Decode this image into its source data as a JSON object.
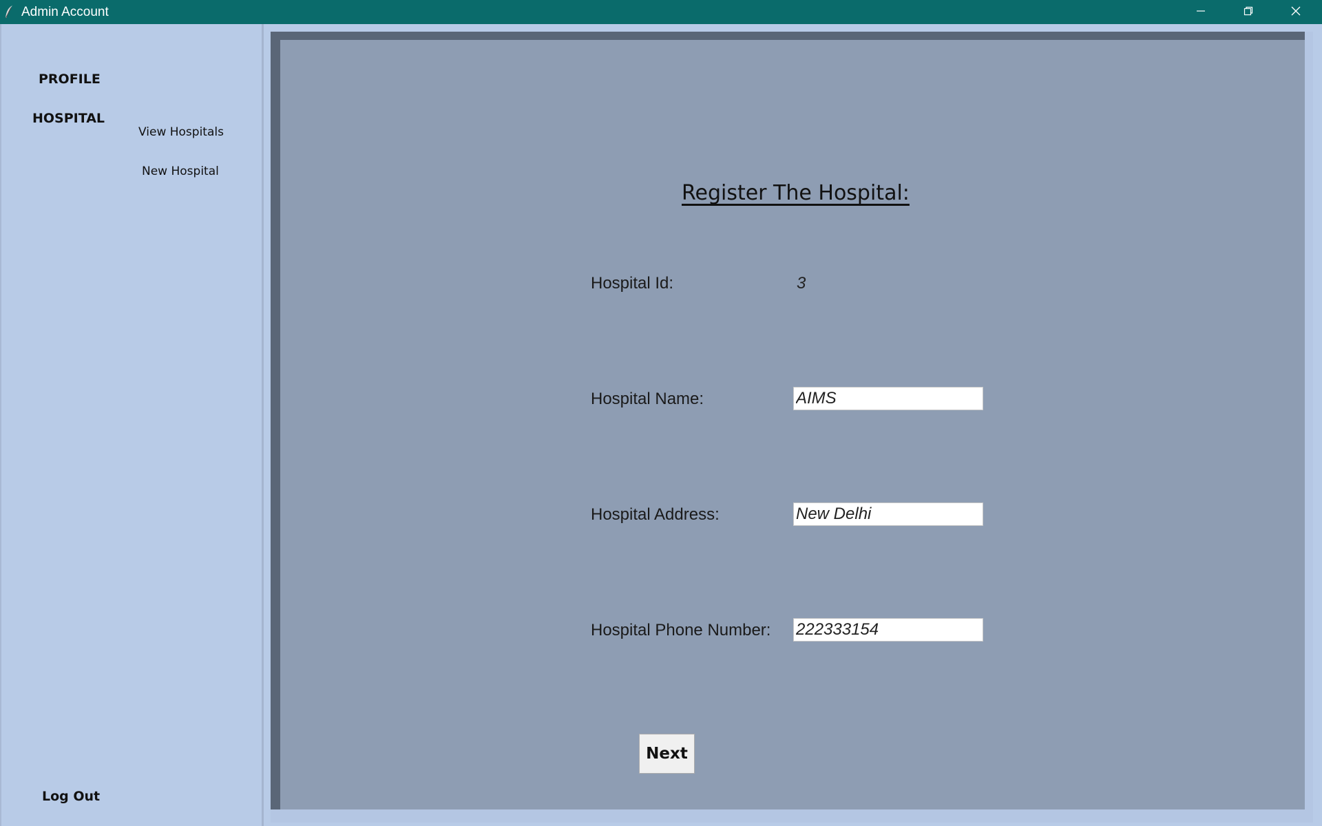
{
  "window": {
    "title": "Admin Account",
    "titlebar_color": "#0a6b6b"
  },
  "sidebar": {
    "profile": "PROFILE",
    "hospital": "HOSPITAL",
    "sub_items": [
      "View Hospitals",
      "New Hospital"
    ],
    "logout": "Log Out"
  },
  "form": {
    "title": "Register The Hospital:",
    "id_label": "Hospital Id:",
    "id_value": "3",
    "name_label": "Hospital Name:",
    "name_value": "AIMS",
    "address_label": "Hospital Address:",
    "address_value": "New Delhi",
    "phone_label": "Hospital Phone Number:",
    "phone_value": "222333154",
    "next_label": "Next"
  },
  "icons": {
    "app": "feather-icon",
    "minimize": "minimize-icon",
    "restore": "restore-icon",
    "close": "close-icon"
  }
}
